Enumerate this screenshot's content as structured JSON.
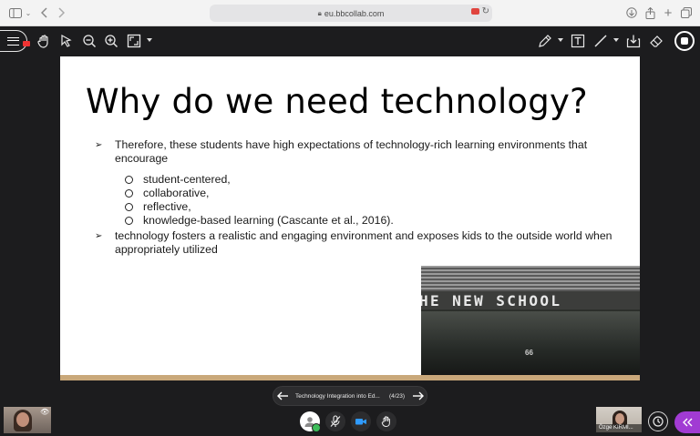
{
  "browser": {
    "url": "eu.bbcollab.com"
  },
  "slide": {
    "title": "Why do we need technology?",
    "bullet1": "Therefore, these students have high expectations of technology-rich learning environments that encourage",
    "subitems": [
      "student-centered,",
      "collaborative,",
      "reflective,",
      "knowledge-based learning (Cascante et al., 2016)."
    ],
    "bullet2": "technology fosters a realistic and engaging environment and exposes kids to the outside world when appropriately utilized",
    "photo_sign": "HE NEW SCHOOL",
    "photo_number": "66",
    "bullet_glyph": "➢"
  },
  "slide_nav": {
    "title": "Technology Integration into Ed...",
    "count": "(4/23)"
  },
  "participants": {
    "right_name": "Özge KIRMI..."
  },
  "colors": {
    "accent": "#a13bd3",
    "background": "#1c1c1e",
    "slide_stripe": "#c9a87a"
  }
}
